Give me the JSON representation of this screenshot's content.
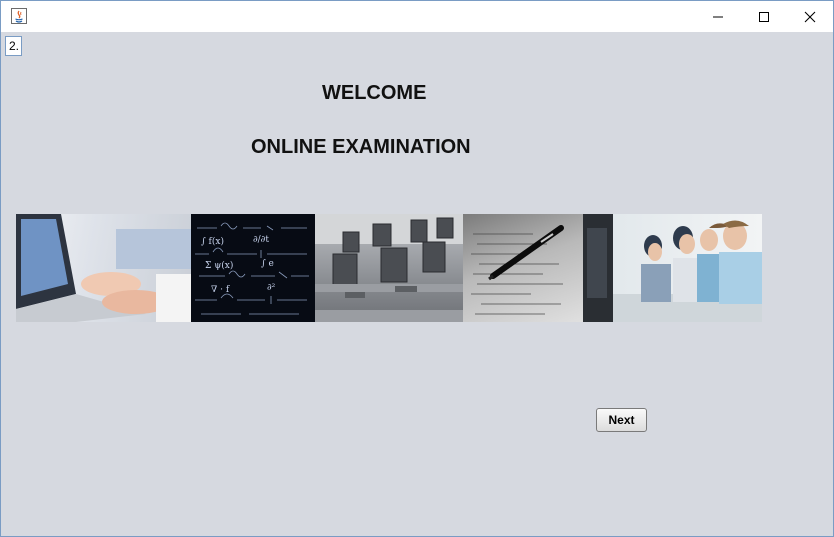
{
  "window": {
    "controls": [
      "minimize-icon",
      "maximize-icon",
      "close-icon"
    ]
  },
  "form": {
    "field_value": "2.",
    "welcome": "WELCOME",
    "subtitle": "ONLINE EXAMINATION",
    "next_label": "Next"
  },
  "banner": {
    "images": [
      "typing-on-laptop",
      "math-formulas-blackboard",
      "computer-lab",
      "pen-on-paper",
      "students-at-computers"
    ]
  }
}
